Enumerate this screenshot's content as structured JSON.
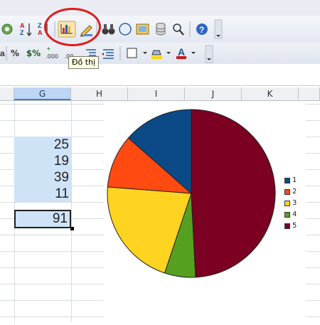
{
  "toolbar": {
    "chart_tooltip": "Đồ thị",
    "percent_label": "%",
    "currency_label": "$%",
    "decimal_add_label": ".000",
    "decimal_remove_label": ".00"
  },
  "spreadsheet": {
    "columns": [
      "G",
      "H",
      "I",
      "J",
      "K"
    ],
    "selected_column": "G",
    "values": [
      "25",
      "19",
      "39",
      "11",
      "91"
    ]
  },
  "chart_data": {
    "type": "pie",
    "categories": [
      "1",
      "2",
      "3",
      "4",
      "5"
    ],
    "values": [
      25,
      19,
      39,
      11,
      91
    ],
    "colors": [
      "#0b4a87",
      "#ff4a12",
      "#ffd420",
      "#55a01f",
      "#7b0022"
    ],
    "legend_position": "right"
  }
}
